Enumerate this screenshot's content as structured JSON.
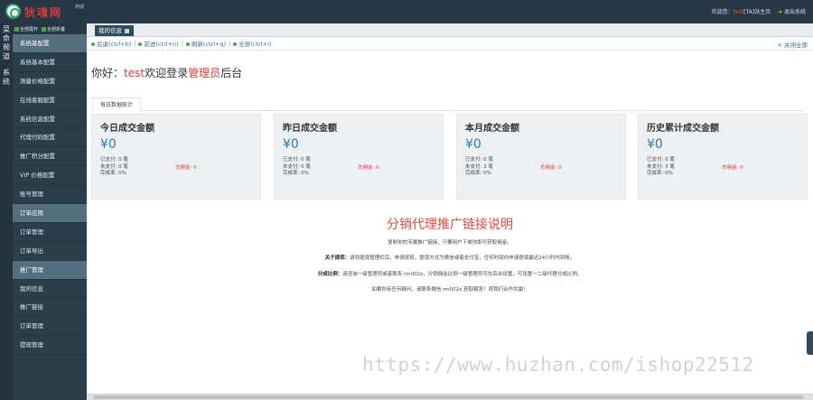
{
  "header": {
    "logo_text": "狄魂网",
    "logo_tag": "商城",
    "welcome_prefix": "欢迎您：",
    "username": "test",
    "front_link": "[TA]站主页",
    "logout": "退出系统"
  },
  "rail": {
    "label1": "菜命频道",
    "label2": "系统"
  },
  "sidebar": {
    "expand_all": "全部展开",
    "collapse_all": "全部折叠",
    "items": [
      {
        "label": "系统基配置",
        "group": true
      },
      {
        "label": "系统基本配置",
        "group": false
      },
      {
        "label": "测量价格配置",
        "group": false
      },
      {
        "label": "在线客服配置",
        "group": false
      },
      {
        "label": "系统信息配置",
        "group": false
      },
      {
        "label": "代理付码配置",
        "group": false
      },
      {
        "label": "推广积分配置",
        "group": false
      },
      {
        "label": "VIP 价格配置",
        "group": false
      },
      {
        "label": "账号管理",
        "group": false
      },
      {
        "label": "订单应用",
        "group": true
      },
      {
        "label": "订单管理",
        "group": false
      },
      {
        "label": "订单导出",
        "group": false
      },
      {
        "label": "推广管理",
        "group": true
      },
      {
        "label": "我的信息",
        "group": false
      },
      {
        "label": "推广链接",
        "group": false
      },
      {
        "label": "订单管理",
        "group": false
      },
      {
        "label": "提现管理",
        "group": false
      }
    ]
  },
  "tabs": {
    "active": "我的信息"
  },
  "toolbar": {
    "back": "后退(ctrl+b)",
    "forward": "前进(ctrl+n)",
    "refresh": "刷新(ctrl+q)",
    "fullscreen": "全屏(ctrl+i)",
    "close_all": "关闭全部"
  },
  "welcome": {
    "hello": "你好：",
    "user": "test",
    "mid": "欢迎登录",
    "role": "管理员",
    "suffix": "后台"
  },
  "section_tab": "每日数据统计",
  "cards": [
    {
      "title": "今日成交金额",
      "amount": "¥0",
      "paid": "已支付: 0 笔",
      "unpaid": "未支付: 0 笔",
      "rate": "完成率: 0%",
      "commission": "总佣金: 0"
    },
    {
      "title": "昨日成交金额",
      "amount": "¥0",
      "paid": "已支付: 0 笔",
      "unpaid": "未支付: 0 笔",
      "rate": "完成率: 0%",
      "commission": "总佣金: 0"
    },
    {
      "title": "本月成交金额",
      "amount": "¥0",
      "paid": "已支付: 0 笔",
      "unpaid": "未支付: 3 笔",
      "rate": "完成率: 0%",
      "commission": "总佣金: 0"
    },
    {
      "title": "历史累计成交金额",
      "amount": "¥0",
      "paid": "已支付: 0 笔",
      "unpaid": "未支付: 3 笔",
      "rate": "完成率: 0%",
      "commission": "总佣金: 0"
    }
  ],
  "promo": {
    "title": "分销代理推广链接说明",
    "line1": "复制你的专属推广链接，只要用户下单你即可获取佣金。",
    "line2_label": "关于提现：",
    "line2": "请到提现管理栏目，申请提现，提现方式为微信或者支付宝，任何时间内申请提现最迟24小时内到账。",
    "line3_label": "分成比例：",
    "line3": "请咨询一级管理员或者联系 rm002x，分销佣金比例一级管理员可在后台设置，可设置一二级代理分成比例。",
    "line4": "如果你有任何疑问，请联系微信 rm002x 获取解答！祝我们合作共赢！"
  },
  "watermark": "https://www.huzhan.com/ishop22512"
}
